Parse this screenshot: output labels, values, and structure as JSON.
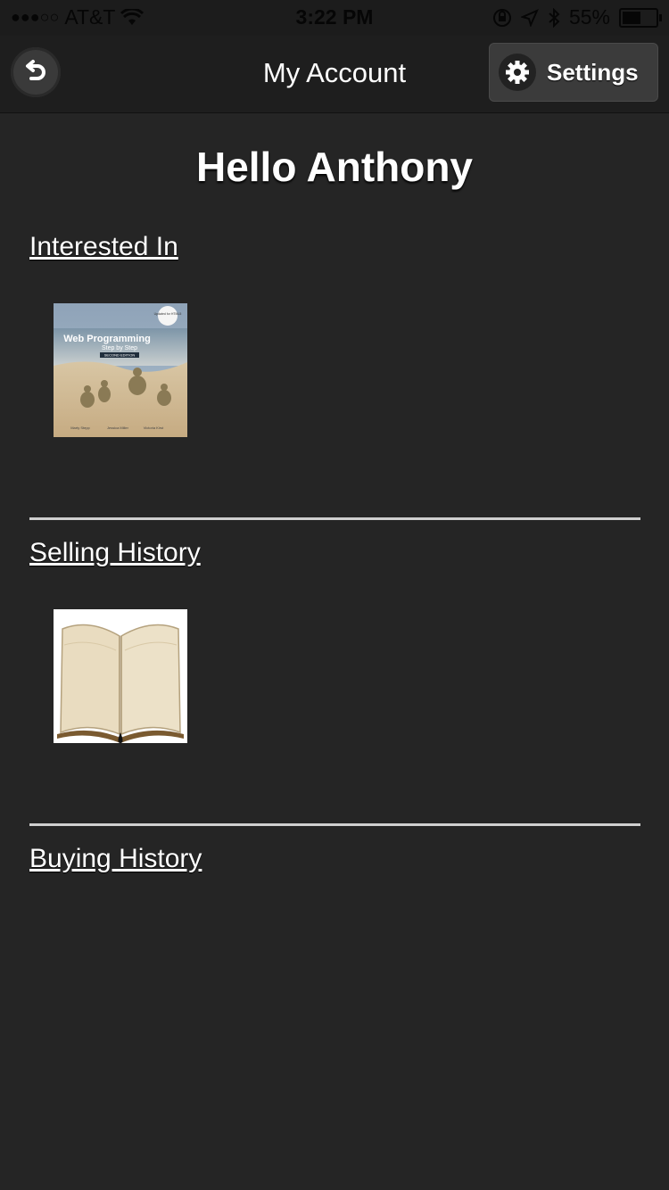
{
  "status_bar": {
    "carrier": "AT&T",
    "time": "3:22 PM",
    "battery": "55%",
    "battery_level": 0.55,
    "icons": [
      "signal-dots-icon",
      "wifi-icon",
      "orientation-lock-icon",
      "location-icon",
      "bluetooth-icon",
      "battery-icon"
    ]
  },
  "nav": {
    "back_icon": "undo-arrow-icon",
    "title": "My Account",
    "settings_label": "Settings",
    "settings_icon": "gear-icon"
  },
  "main": {
    "greeting": "Hello Anthony",
    "sections": [
      {
        "heading": "Interested In",
        "item": {
          "book_title": "Web Programming",
          "book_subtitle": "Step by Step",
          "edition": "SECOND EDITION",
          "sticker": "Updated for HTML5",
          "authors": [
            "Marty Stepp",
            "Jessica Miller",
            "Victoria Kirst"
          ]
        }
      },
      {
        "heading": "Selling History",
        "item": {
          "image": "open-book-image"
        }
      },
      {
        "heading": "Buying History"
      }
    ]
  },
  "colors": {
    "background": "#252525",
    "nav_background": "#1e1e1e",
    "divider": "#cfcfcf",
    "text": "#ffffff"
  }
}
